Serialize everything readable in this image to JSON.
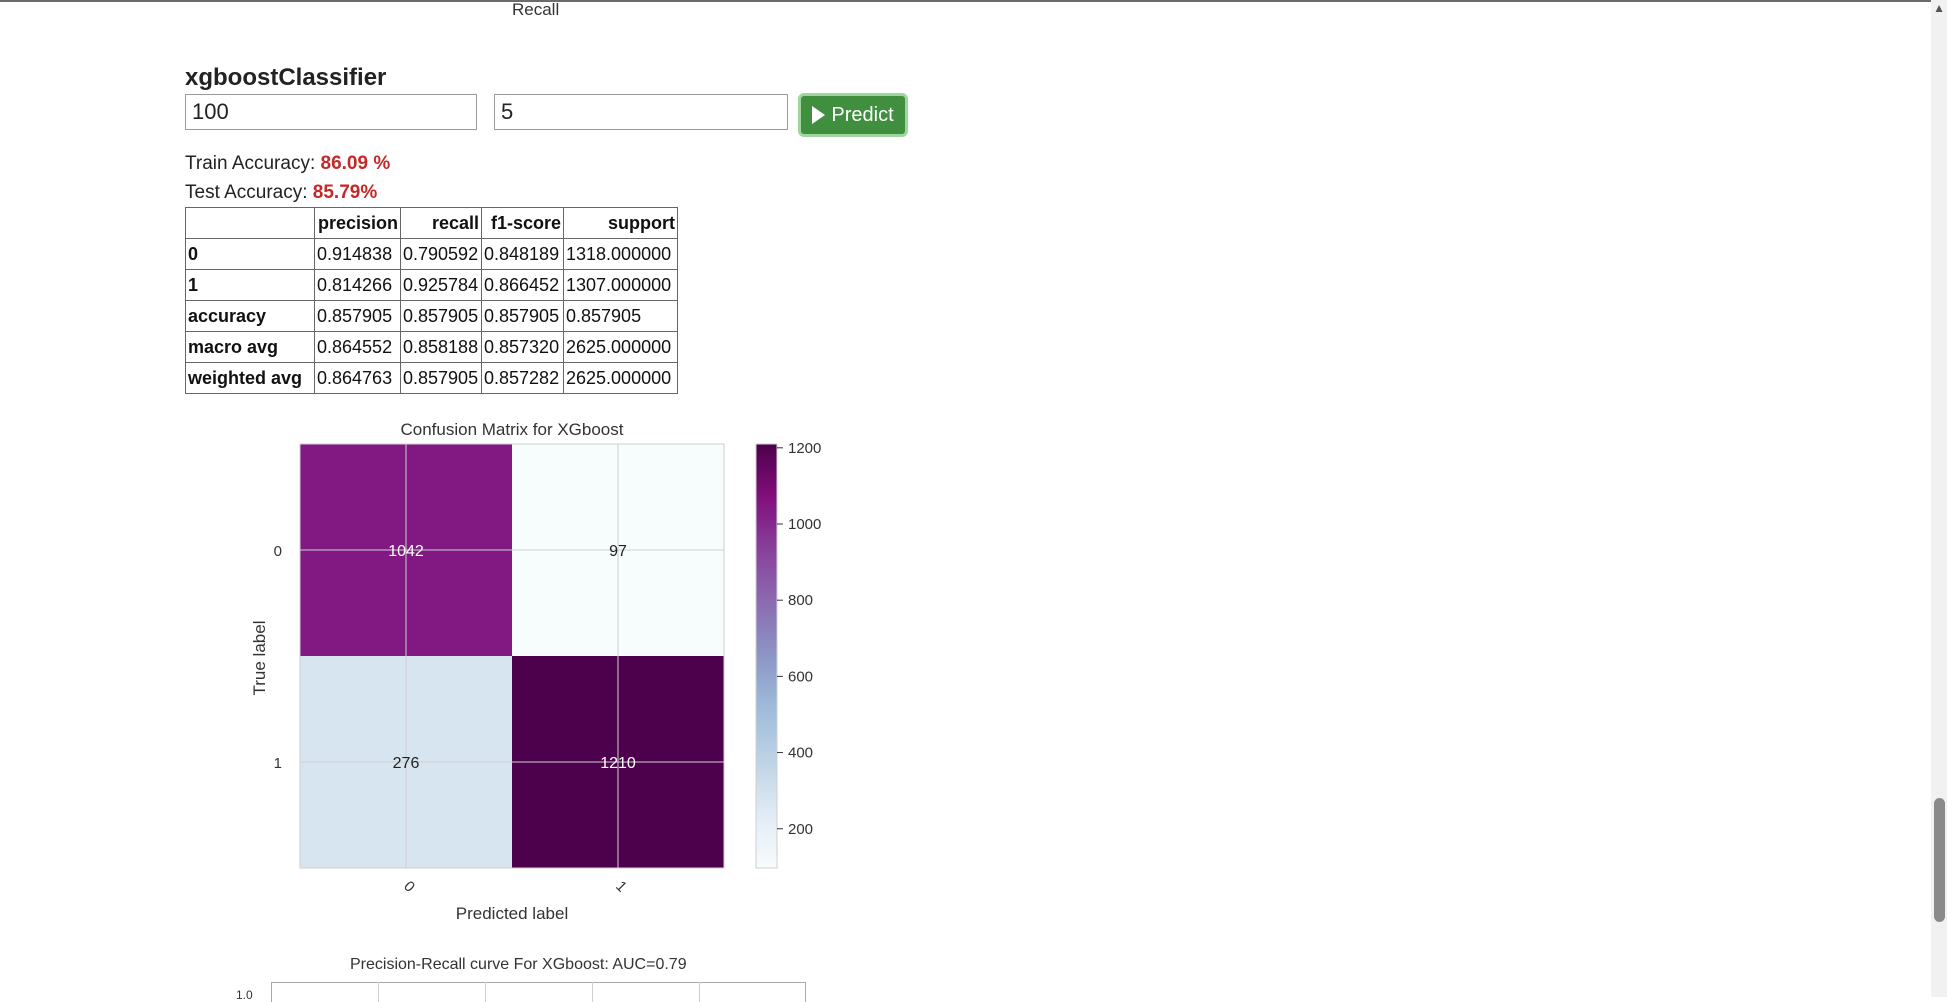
{
  "top_label": "Recall",
  "model": {
    "title": "xgboostClassifier",
    "param1_value": "100",
    "param2_value": "5",
    "predict_label": "Predict"
  },
  "accuracy": {
    "train_label": "Train Accuracy: ",
    "train_value": "86.09 %",
    "test_label": "Test Accuracy: ",
    "test_value": "85.79%"
  },
  "report": {
    "headers": [
      "",
      "precision",
      "recall",
      "f1-score",
      "support"
    ],
    "rows": [
      [
        "0",
        "0.914838",
        "0.790592",
        "0.848189",
        "1318.000000"
      ],
      [
        "1",
        "0.814266",
        "0.925784",
        "0.866452",
        "1307.000000"
      ],
      [
        "accuracy",
        "0.857905",
        "0.857905",
        "0.857905",
        "0.857905"
      ],
      [
        "macro avg",
        "0.864552",
        "0.858188",
        "0.857320",
        "2625.000000"
      ],
      [
        "weighted avg",
        "0.864763",
        "0.857905",
        "0.857282",
        "2625.000000"
      ]
    ]
  },
  "chart_data": {
    "type": "heatmap",
    "title": "Confusion Matrix for XGboost",
    "xlabel": "Predicted label",
    "ylabel": "True label",
    "x_ticks": [
      "0",
      "1"
    ],
    "y_ticks": [
      "0",
      "1"
    ],
    "values": [
      [
        1042,
        97
      ],
      [
        276,
        1210
      ]
    ],
    "colormap": "BuPu",
    "colorbar_range": [
      97,
      1210
    ],
    "colorbar_ticks": [
      200,
      400,
      600,
      800,
      1000,
      1200
    ],
    "grid": true
  },
  "next_chart": {
    "title": "Precision-Recall curve For XGboost: AUC=0.79",
    "tick": "1.0"
  }
}
